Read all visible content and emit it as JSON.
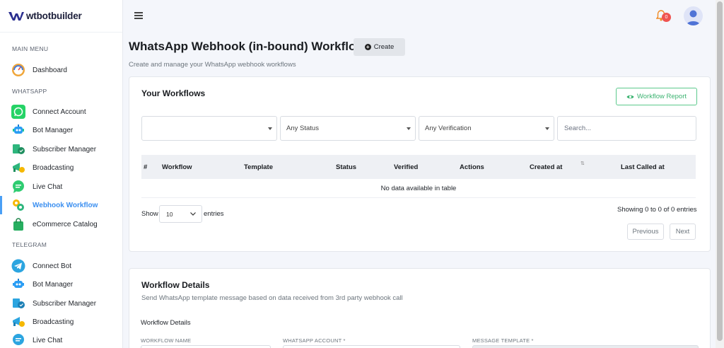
{
  "brand": {
    "name": "wtbotbuilder"
  },
  "colors": {
    "accent": "#3b8ff0",
    "success": "#3cb371",
    "badge": "#ef5350"
  },
  "sidebar": {
    "main_menu": "MAIN MENU",
    "whatsapp": "WHATSAPP",
    "telegram": "TELEGRAM",
    "main_items": [
      {
        "label": "Dashboard",
        "icon": "dashboard-gauge-icon"
      }
    ],
    "whatsapp_items": [
      {
        "label": "Connect Account",
        "icon": "whatsapp-icon"
      },
      {
        "label": "Bot Manager",
        "icon": "robot-icon"
      },
      {
        "label": "Subscriber Manager",
        "icon": "subscriber-icon"
      },
      {
        "label": "Broadcasting",
        "icon": "broadcast-icon"
      },
      {
        "label": "Live Chat",
        "icon": "chat-bubble-icon"
      },
      {
        "label": "Webhook Workflow",
        "icon": "webhook-icon",
        "active": true
      },
      {
        "label": "eCommerce Catalog",
        "icon": "shopping-bag-icon"
      }
    ],
    "telegram_items": [
      {
        "label": "Connect Bot",
        "icon": "telegram-icon"
      },
      {
        "label": "Bot Manager",
        "icon": "robot-icon"
      },
      {
        "label": "Subscriber Manager",
        "icon": "subscriber-icon"
      },
      {
        "label": "Broadcasting",
        "icon": "broadcast-icon"
      },
      {
        "label": "Live Chat",
        "icon": "chat-bubble-icon"
      }
    ]
  },
  "topbar": {
    "notification_count": "0"
  },
  "page": {
    "title": "WhatsApp Webhook (in-bound) Workflow",
    "create_label": "Create",
    "subtitle": "Create and manage your WhatsApp webhook workflows"
  },
  "workflows": {
    "title": "Your Workflows",
    "report_label": "Workflow Report",
    "filters": {
      "workflow": "",
      "status": "Any Status",
      "verification": "Any Verification"
    },
    "search_placeholder": "Search...",
    "columns": [
      "#",
      "Workflow",
      "Template",
      "Status",
      "Verified",
      "Actions",
      "Created at",
      "Last Called at"
    ],
    "sort_icon": "⇅",
    "empty_text": "No data available in table",
    "show_label": "Show",
    "page_length": "10",
    "entries_label": "entries",
    "info": "Showing 0 to 0 of 0 entries",
    "previous": "Previous",
    "next": "Next"
  },
  "details": {
    "title": "Workflow Details",
    "subtitle": "Send WhatsApp template message based on data received from 3rd party webhook call",
    "section_label": "Workflow Details",
    "fields": [
      "WORKFLOW NAME",
      "WHATSAPP ACCOUNT *",
      "MESSAGE TEMPLATE *"
    ]
  }
}
